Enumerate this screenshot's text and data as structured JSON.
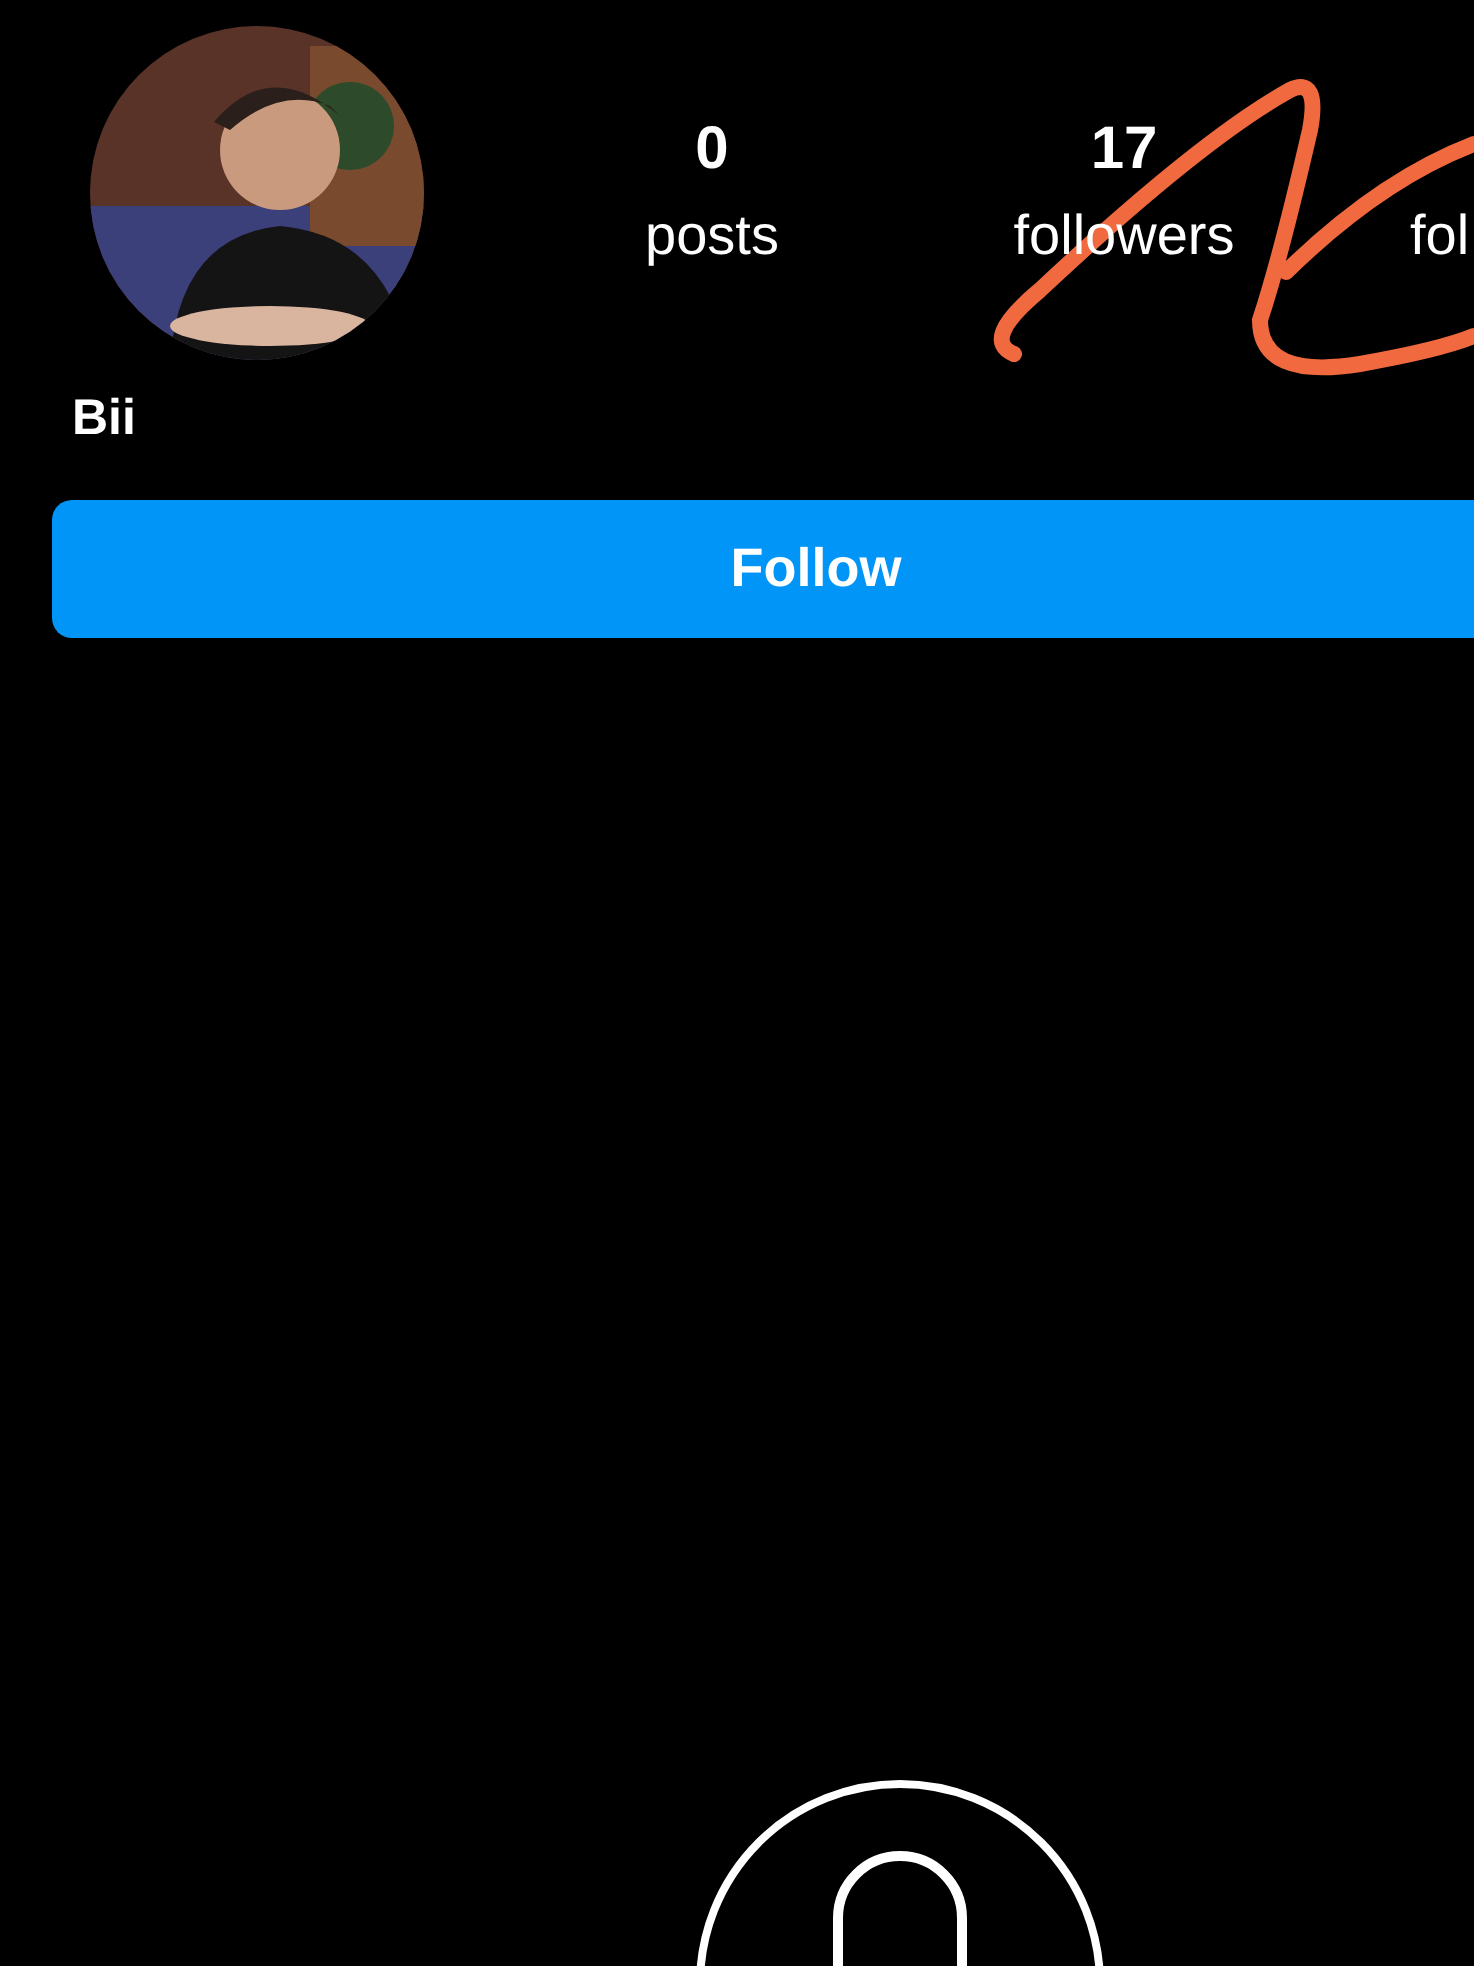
{
  "profile": {
    "name": "Bii"
  },
  "stats": [
    {
      "count": "0",
      "label": "posts"
    },
    {
      "count": "17",
      "label": "followers"
    },
    {
      "label": "fol"
    }
  ],
  "follow_button": {
    "label": "Follow"
  }
}
